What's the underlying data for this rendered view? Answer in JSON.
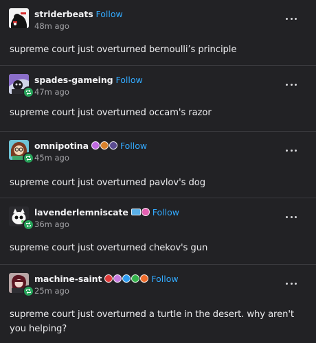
{
  "follow_label": "Follow",
  "colors": {
    "background": "#222225",
    "follow": "#33aaff",
    "reblog": "#27a35a",
    "divider": "#3a3a3e"
  },
  "posts": [
    {
      "username": "striderbeats",
      "timestamp": "48m ago",
      "text": "supreme court just overturned bernoulli’s principle",
      "badges": [],
      "reblog_icon": false
    },
    {
      "username": "spades-gameing",
      "timestamp": "47m ago",
      "text": "supreme court just overturned occam's razor",
      "badges": [],
      "reblog_icon": true
    },
    {
      "username": "omnipotina",
      "timestamp": "45m ago",
      "text": "supreme court just overturned pavlov's dog",
      "badges": [
        "#c06adf",
        "#d9812a",
        "#5a4b8f"
      ],
      "reblog_icon": true
    },
    {
      "username": "lavenderlemniscate",
      "timestamp": "36m ago",
      "text": "supreme court just overturned chekov's gun",
      "badges": [
        "#5ab0e8",
        "#e35fb1"
      ],
      "reblog_icon": true
    },
    {
      "username": "machine-saint",
      "timestamp": "25m ago",
      "text": "supreme court just overturned a turtle in the desert. why aren't you helping?",
      "badges": [
        "#e03a3a",
        "#c77be0",
        "#2d9cf0",
        "#33b24a",
        "#ef6b2a"
      ],
      "reblog_icon": true
    }
  ]
}
